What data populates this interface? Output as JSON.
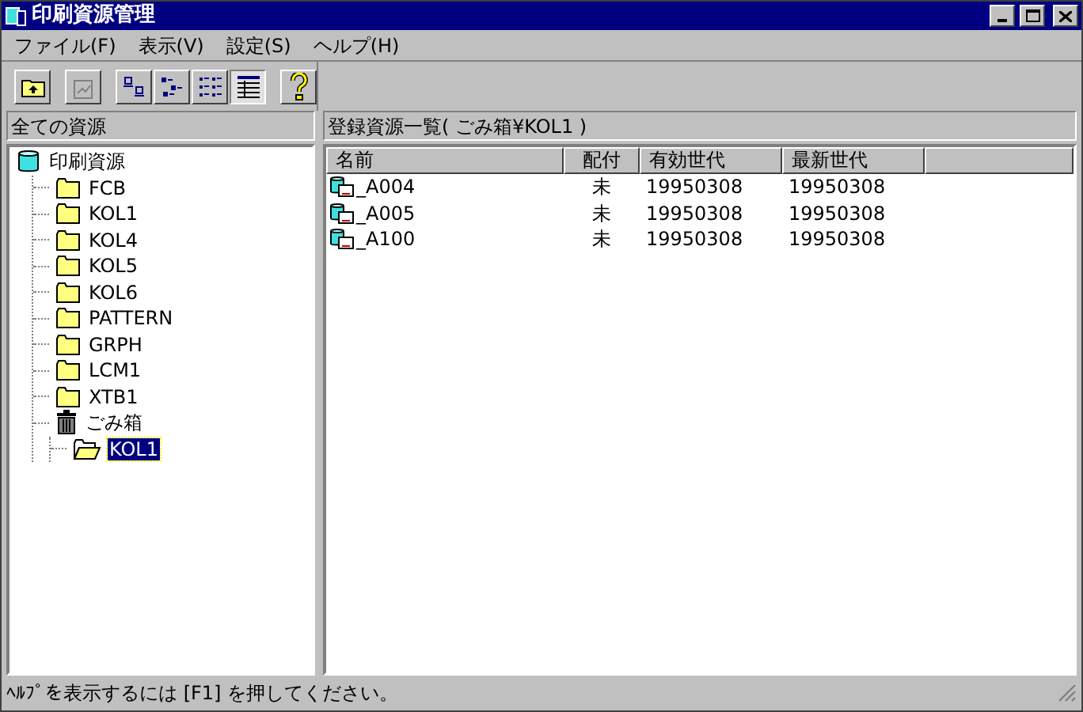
{
  "window": {
    "title": "印刷資源管理"
  },
  "menu": [
    "ファイル(F)",
    "表示(V)",
    "設定(S)",
    "ヘルプ(H)"
  ],
  "toolbar": [
    {
      "kind": "up",
      "disabled": false,
      "pressed": false
    },
    {
      "kind": "properties",
      "disabled": true,
      "pressed": false
    },
    {
      "kind": "large-icons",
      "disabled": false,
      "pressed": false
    },
    {
      "kind": "small-icons",
      "disabled": false,
      "pressed": false
    },
    {
      "kind": "list",
      "disabled": false,
      "pressed": false
    },
    {
      "kind": "details",
      "disabled": false,
      "pressed": true
    },
    {
      "kind": "help",
      "disabled": false,
      "pressed": false
    }
  ],
  "tree": {
    "header": "全ての資源",
    "items": [
      {
        "label": "印刷資源",
        "kind": "database",
        "selected": false,
        "children": [
          {
            "label": "FCB",
            "kind": "folder",
            "selected": false
          },
          {
            "label": "KOL1",
            "kind": "folder",
            "selected": false
          },
          {
            "label": "KOL4",
            "kind": "folder",
            "selected": false
          },
          {
            "label": "KOL5",
            "kind": "folder",
            "selected": false
          },
          {
            "label": "KOL6",
            "kind": "folder",
            "selected": false
          },
          {
            "label": "PATTERN",
            "kind": "folder",
            "selected": false
          },
          {
            "label": "GRPH",
            "kind": "folder",
            "selected": false
          },
          {
            "label": "LCM1",
            "kind": "folder",
            "selected": false
          },
          {
            "label": "XTB1",
            "kind": "folder",
            "selected": false
          },
          {
            "label": "ごみ箱",
            "kind": "trash",
            "selected": false,
            "children": [
              {
                "label": "KOL1",
                "kind": "open-folder",
                "selected": true
              }
            ]
          }
        ]
      }
    ]
  },
  "list": {
    "header": "登録資源一覧( ごみ箱¥KOL1 )",
    "columns": [
      "名前",
      "配付",
      "有効世代",
      "最新世代"
    ],
    "rows": [
      {
        "cells": [
          "_A004",
          "未",
          "19950308",
          "19950308"
        ]
      },
      {
        "cells": [
          "_A005",
          "未",
          "19950308",
          "19950308"
        ]
      },
      {
        "cells": [
          "_A100",
          "未",
          "19950308",
          "19950308"
        ]
      }
    ]
  },
  "status_bar": "ﾍﾙﾌﾟを表示するには [F1] を押してください。"
}
